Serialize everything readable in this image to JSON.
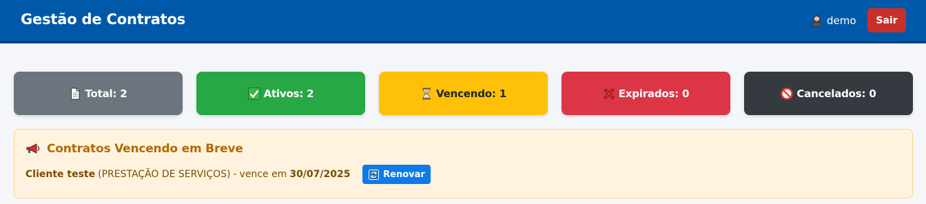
{
  "header": {
    "title": "Gestão de Contratos",
    "user_icon": "user-icon",
    "username": "demo",
    "logout_label": "Sair"
  },
  "stats": [
    {
      "icon": "document-icon",
      "label": "Total: 2",
      "color": "#6c757d"
    },
    {
      "icon": "check-icon",
      "label": "Ativos: 2",
      "color": "#28a745"
    },
    {
      "icon": "hourglass-icon",
      "label": "Vencendo: 1",
      "color": "#ffc107"
    },
    {
      "icon": "cross-icon",
      "label": "Expirados: 0",
      "color": "#dc3545"
    },
    {
      "icon": "prohibited-icon",
      "label": "Cancelados: 0",
      "color": "#343a40"
    }
  ],
  "alert": {
    "icon": "megaphone-icon",
    "title": "Contratos Vencendo em Breve",
    "items": [
      {
        "client": "Cliente teste",
        "type": "(PRESTAÇÃO DE SERVIÇOS)",
        "sep": "-",
        "due_prefix": "vence em",
        "date": "30/07/2025",
        "action_icon": "refresh-icon",
        "action_label": "Renovar"
      }
    ]
  },
  "colors": {
    "header_bg": "#0059a8",
    "logout": "#c9302c",
    "alert_bg": "#fff3e0",
    "alert_text": "#b06a00",
    "renew": "#0d7bea"
  }
}
